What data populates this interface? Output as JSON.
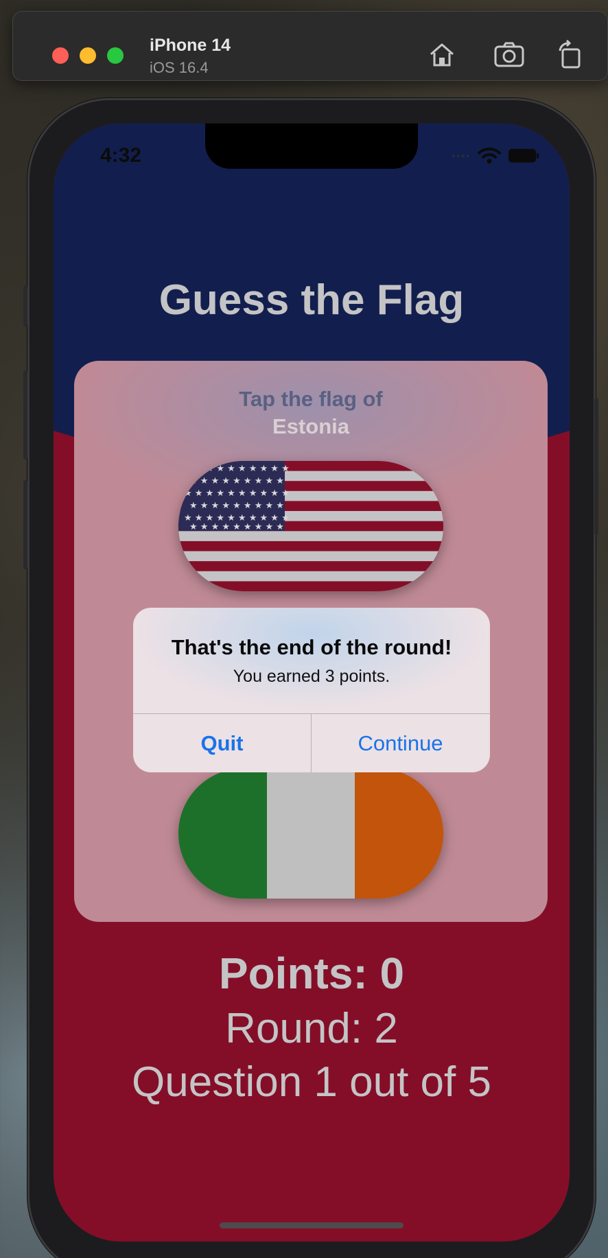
{
  "simulator": {
    "device_name": "iPhone 14",
    "os_version": "iOS 16.4",
    "toolbar_icons": [
      "home-icon",
      "screenshot-icon",
      "rotate-icon"
    ],
    "traffic_light_colors": [
      "#ff5f57",
      "#febc2e",
      "#28c840"
    ]
  },
  "status_bar": {
    "time": "4:32",
    "icons": [
      "signal-dots-icon",
      "wifi-icon",
      "battery-icon"
    ]
  },
  "app": {
    "title": "Guess the Flag",
    "prompt_label": "Tap the flag of",
    "prompt_country": "Estonia",
    "flags": [
      {
        "name": "United States",
        "icon": "us-flag"
      },
      {
        "name": "Ireland",
        "icon": "ireland-flag"
      }
    ],
    "points_text": "Points: 0",
    "round_text": "Round: 2",
    "question_text": "Question 1 out of 5"
  },
  "alert": {
    "title": "That's the end of the round!",
    "message": "You earned 3 points.",
    "buttons": {
      "quit": "Quit",
      "continue": "Continue"
    }
  },
  "colors": {
    "navy": "#121f4e",
    "crimson": "#840e28",
    "accent_blue": "#1a73e8"
  }
}
